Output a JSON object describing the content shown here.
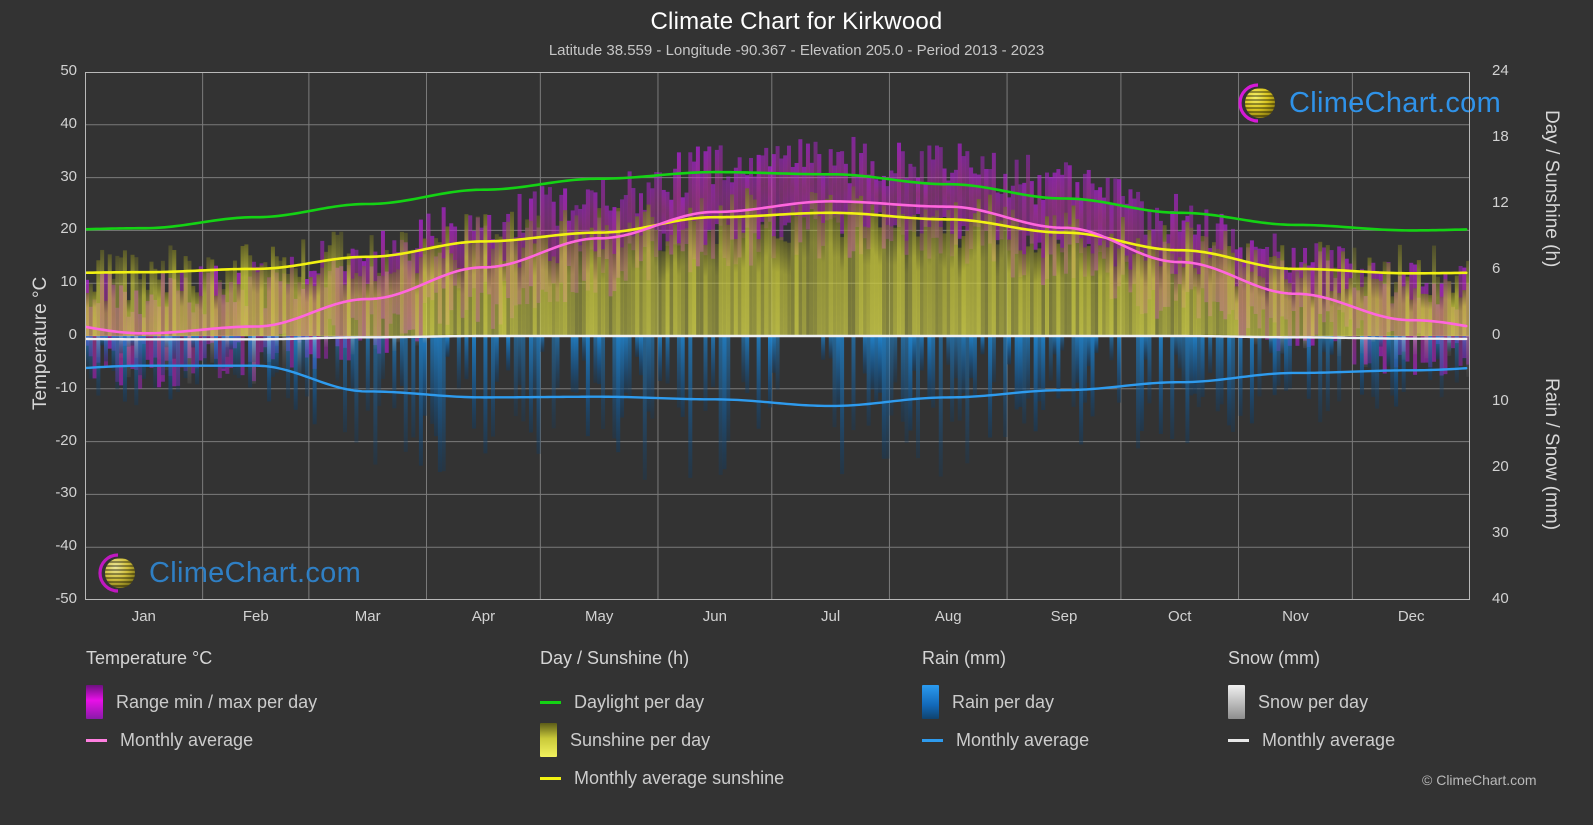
{
  "header": {
    "title": "Climate Chart for Kirkwood",
    "subtitle": "Latitude 38.559 - Longitude -90.367 - Elevation 205.0 - Period 2013 - 2023"
  },
  "axes": {
    "left_label": "Temperature °C",
    "right_label_top": "Day / Sunshine (h)",
    "right_label_bottom": "Rain / Snow (mm)",
    "left_ticks": [
      "50",
      "40",
      "30",
      "20",
      "10",
      "0",
      "-10",
      "-20",
      "-30",
      "-40",
      "-50"
    ],
    "right_ticks_top": [
      "24",
      "18",
      "12",
      "6",
      "0"
    ],
    "right_ticks_bottom": [
      "10",
      "20",
      "30",
      "40"
    ],
    "x_ticks": [
      "Jan",
      "Feb",
      "Mar",
      "Apr",
      "May",
      "Jun",
      "Jul",
      "Aug",
      "Sep",
      "Oct",
      "Nov",
      "Dec"
    ]
  },
  "legend": {
    "groups": [
      {
        "title": "Temperature °C",
        "items": [
          {
            "label": "Range min / max per day",
            "swatch": "gradient",
            "color": "#e810e8"
          },
          {
            "label": "Monthly average",
            "swatch": "line",
            "color": "#ff7fe0"
          }
        ]
      },
      {
        "title": "Day / Sunshine (h)",
        "items": [
          {
            "label": "Daylight per day",
            "swatch": "line",
            "color": "#14d314"
          },
          {
            "label": "Sunshine per day",
            "swatch": "gradient",
            "color": "#eded3a"
          },
          {
            "label": "Monthly average sunshine",
            "swatch": "line",
            "color": "#f2f212"
          }
        ]
      },
      {
        "title": "Rain (mm)",
        "items": [
          {
            "label": "Rain per day",
            "swatch": "gradient",
            "color": "#1484e0"
          },
          {
            "label": "Monthly average",
            "swatch": "line",
            "color": "#2e9bee"
          }
        ]
      },
      {
        "title": "Snow (mm)",
        "items": [
          {
            "label": "Snow per day",
            "swatch": "gradient",
            "color": "#e8e8e8"
          },
          {
            "label": "Monthly average",
            "swatch": "line",
            "color": "#e8e8e8"
          }
        ]
      }
    ]
  },
  "watermark": {
    "text": "ClimeChart.com"
  },
  "copyright": "© ClimeChart.com",
  "colors": {
    "background": "#333333",
    "grid": "#777777",
    "frame": "#b9b9b9",
    "daylight": "#14d314",
    "sunshine_avg": "#f2f212",
    "temperature_avg": "#ff66dd",
    "rain_avg": "#2e9bee",
    "snow_avg": "#f0f0f0",
    "temp_range": "#e810e8",
    "sunshine_fill": "#d6d63c",
    "rain_fill": "#1484e0"
  },
  "chart_data": {
    "type": "area",
    "title": "Climate Chart for Kirkwood",
    "subtitle": "Latitude 38.559 - Longitude -90.367 - Elevation 205.0 - Period 2013 - 2023",
    "xlabel": "",
    "ylabel": "Temperature °C",
    "ylabel_right_top": "Day / Sunshine (h)",
    "ylabel_right_bottom": "Rain / Snow (mm)",
    "ylim": [
      -50,
      50
    ],
    "ylim_right_top": [
      0,
      24
    ],
    "ylim_right_bottom": [
      0,
      40
    ],
    "grid": true,
    "legend_position": "below",
    "categories": [
      "Jan",
      "Feb",
      "Mar",
      "Apr",
      "May",
      "Jun",
      "Jul",
      "Aug",
      "Sep",
      "Oct",
      "Nov",
      "Dec"
    ],
    "series": [
      {
        "name": "Monthly average temperature",
        "unit": "°C",
        "axis": "left",
        "color": "#ff66dd",
        "values": [
          0.5,
          1.8,
          7.0,
          13.0,
          18.5,
          23.5,
          25.5,
          24.5,
          20.5,
          14.0,
          8.0,
          3.0
        ]
      },
      {
        "name": "Daily maximum temperature (range top)",
        "unit": "°C",
        "axis": "left",
        "color": "#e810e8",
        "values": [
          6.5,
          9.0,
          15.0,
          21.0,
          26.0,
          31.0,
          32.5,
          31.5,
          28.0,
          21.5,
          14.5,
          8.5
        ]
      },
      {
        "name": "Daily minimum temperature (range bottom)",
        "unit": "°C",
        "axis": "left",
        "color": "#e810e8",
        "values": [
          -5.5,
          -4.0,
          0.5,
          6.0,
          12.0,
          17.5,
          19.5,
          18.5,
          13.5,
          7.0,
          1.5,
          -3.0
        ]
      },
      {
        "name": "Daylight per day",
        "unit": "h",
        "axis": "right_top",
        "color": "#14d314",
        "values": [
          9.8,
          10.8,
          12.0,
          13.3,
          14.3,
          14.9,
          14.7,
          13.8,
          12.5,
          11.2,
          10.1,
          9.6
        ]
      },
      {
        "name": "Monthly average sunshine",
        "unit": "h",
        "axis": "right_top",
        "color": "#f2f212",
        "values": [
          5.8,
          6.1,
          7.2,
          8.6,
          9.4,
          10.8,
          11.2,
          10.6,
          9.4,
          7.8,
          6.1,
          5.7
        ]
      },
      {
        "name": "Rain monthly average",
        "unit": "mm",
        "axis": "right_bottom",
        "color": "#2e9bee",
        "values": [
          4.5,
          4.5,
          8.4,
          9.3,
          9.2,
          9.6,
          10.6,
          9.3,
          8.2,
          7.0,
          5.6,
          5.2
        ]
      },
      {
        "name": "Snow monthly average",
        "unit": "mm",
        "axis": "right_bottom",
        "color": "#f0f0f0",
        "values": [
          0.5,
          0.5,
          0.2,
          0.0,
          0.0,
          0.0,
          0.0,
          0.0,
          0.0,
          0.0,
          0.2,
          0.4
        ]
      }
    ]
  }
}
